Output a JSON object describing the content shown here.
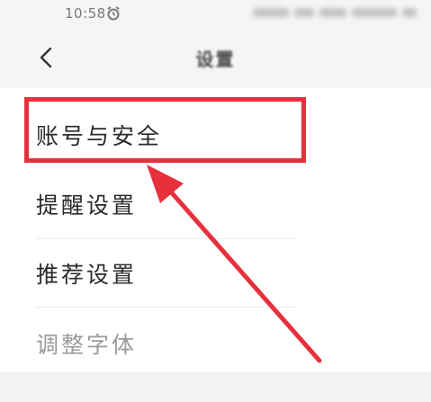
{
  "status_bar": {
    "time": "10:58"
  },
  "nav": {
    "title": "设置"
  },
  "settings_items": [
    {
      "label": "账号与安全"
    },
    {
      "label": "提醒设置"
    },
    {
      "label": "推荐设置"
    },
    {
      "label": "调整字体"
    }
  ],
  "colors": {
    "highlight": "#e8303d",
    "background": "#f5f5f5",
    "list_bg": "#ffffff"
  },
  "icons": {
    "back": "chevron-left-icon",
    "alarm": "alarm-clock-icon"
  }
}
